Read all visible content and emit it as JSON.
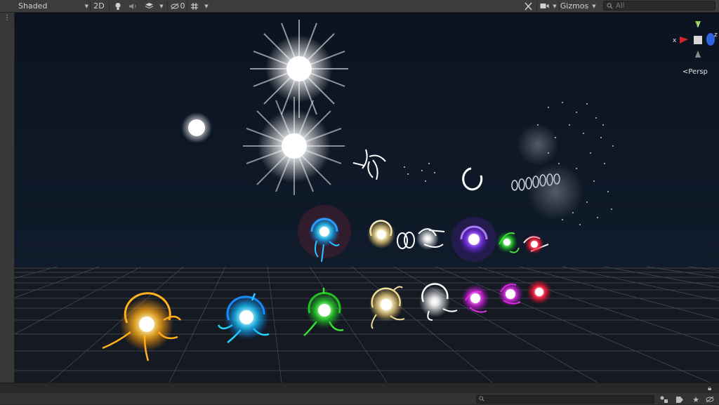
{
  "toolbar": {
    "draw_mode": "Shaded",
    "mode_2d": "2D",
    "visibility_count": "0",
    "gizmos_label": "Gizmos",
    "search_placeholder": "All"
  },
  "orientation_gizmo": {
    "axis_x": "x",
    "axis_y": "y",
    "axis_z": "z",
    "projection_label": "<Persp"
  },
  "icons": {
    "lighting": "lightbulb-icon",
    "audio": "speaker-icon",
    "effects": "layers-icon",
    "hidden": "eye-slash-icon",
    "grid": "grid-icon",
    "tools": "tools-icon",
    "camera": "camera-icon",
    "search": "search-icon",
    "lock": "lock-icon"
  },
  "colors": {
    "x_axis": "#d0262b",
    "y_axis": "#79c12c",
    "z_axis": "#2f63e0",
    "sky": "#0e1726"
  }
}
